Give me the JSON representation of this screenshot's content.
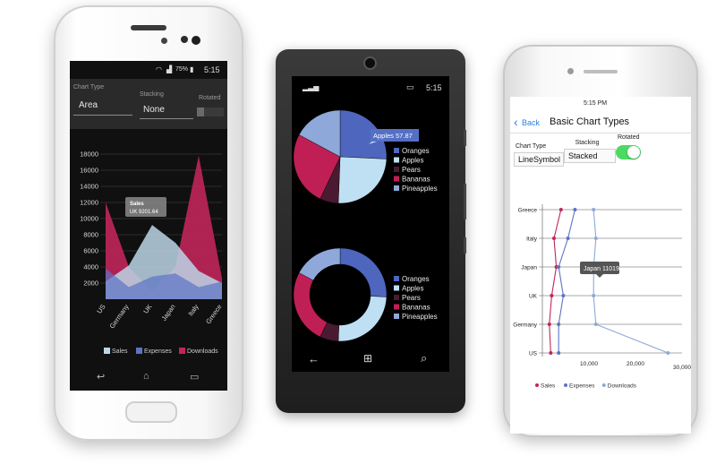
{
  "android": {
    "status": {
      "battery": "75%",
      "time": "5:15"
    },
    "header": {
      "chart_type_label": "Chart Type",
      "chart_type_value": "Area",
      "stacking_label": "Stacking",
      "stacking_value": "None",
      "rotated_label": "Rotated"
    },
    "tooltip": {
      "title": "Sales",
      "text": "UK 9201.64"
    },
    "legend": [
      "Sales",
      "Expenses",
      "Downloads"
    ]
  },
  "windows": {
    "status": {
      "time": "5:15"
    },
    "tooltip": "Apples 57.87",
    "legend": [
      "Oranges",
      "Apples",
      "Pears",
      "Bananas",
      "Pineapples"
    ]
  },
  "iphone": {
    "status": {
      "time": "5:15 PM"
    },
    "nav": {
      "back": "Back",
      "title": "Basic Chart Types"
    },
    "controls": {
      "chart_type_label": "Chart Type",
      "chart_type_value": "LineSymbol",
      "stacking_label": "Stacking",
      "stacking_value": "Stacked",
      "rotated_label": "Rotated"
    },
    "tooltip": "Japan 11019",
    "legend": [
      "Sales",
      "Expenses",
      "Downloads"
    ]
  },
  "colors": {
    "sales": "#bcd6e8",
    "expenses": "#5b74c4",
    "downloads": "#c0265a",
    "oranges": "#4f66bf",
    "apples": "#bfe0f3",
    "pears": "#4a1932",
    "bananas": "#c01f55",
    "pineapples": "#8ea9d9"
  },
  "chart_data": [
    {
      "type": "area",
      "categories": [
        "US",
        "Germany",
        "UK",
        "Japan",
        "Italy",
        "Greece"
      ],
      "ylim": [
        0,
        18000
      ],
      "yticks": [
        "2000",
        "4000",
        "6000",
        "8000",
        "10000",
        "12000",
        "14000",
        "16000",
        "18000"
      ],
      "series": [
        {
          "name": "Sales",
          "values": [
            2200,
            4200,
            9201.64,
            7000,
            3500,
            2000
          ]
        },
        {
          "name": "Expenses",
          "values": [
            3800,
            1500,
            2800,
            3200,
            1500,
            2200
          ]
        },
        {
          "name": "Downloads",
          "values": [
            12000,
            4000,
            1000,
            4000,
            17800,
            2600
          ]
        }
      ]
    },
    {
      "type": "pie",
      "categories": [
        "Oranges",
        "Apples",
        "Pears",
        "Bananas",
        "Pineapples"
      ],
      "values": [
        60,
        57.87,
        15,
        60,
        40
      ]
    },
    {
      "type": "pie",
      "subtype": "doughnut",
      "categories": [
        "Oranges",
        "Apples",
        "Pears",
        "Bananas",
        "Pineapples"
      ],
      "values": [
        60,
        57.87,
        15,
        60,
        40
      ]
    },
    {
      "type": "line",
      "orientation": "rotated",
      "categories": [
        "Greece",
        "Italy",
        "Japan",
        "UK",
        "Germany",
        "US"
      ],
      "xlim": [
        0,
        30000
      ],
      "xticks": [
        "10,000",
        "20,000",
        "30,000"
      ],
      "series": [
        {
          "name": "Sales",
          "values": [
            4000,
            2500,
            3000,
            2000,
            1500,
            1800
          ]
        },
        {
          "name": "Expenses",
          "values": [
            7000,
            5500,
            3500,
            4500,
            3500,
            3500
          ]
        },
        {
          "name": "Downloads",
          "values": [
            11000,
            11500,
            11019,
            11000,
            11500,
            27000
          ]
        }
      ]
    }
  ]
}
